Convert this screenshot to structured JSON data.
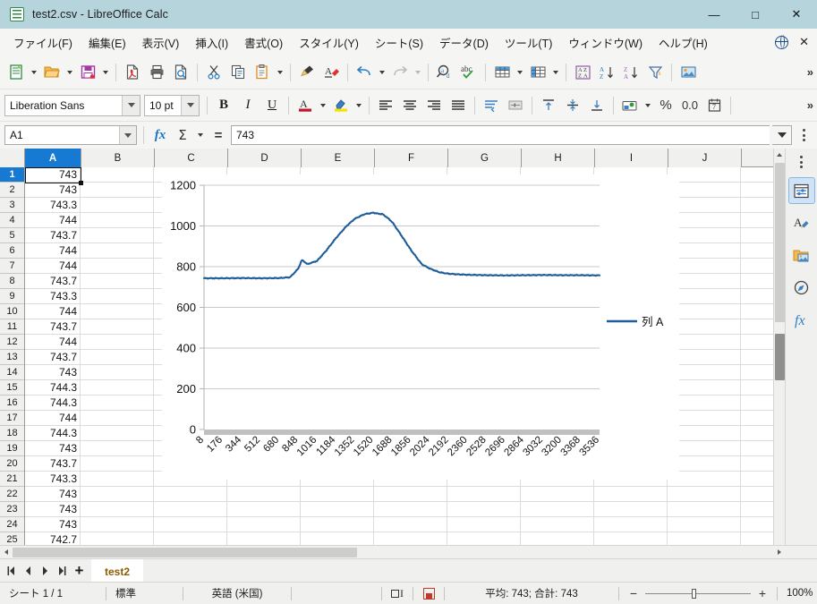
{
  "window": {
    "title": "test2.csv - LibreOffice Calc",
    "minimize": "—",
    "maximize": "□",
    "close": "✕"
  },
  "menubar": {
    "items": [
      {
        "label": "ファイル(F)"
      },
      {
        "label": "編集(E)"
      },
      {
        "label": "表示(V)"
      },
      {
        "label": "挿入(I)"
      },
      {
        "label": "書式(O)"
      },
      {
        "label": "スタイル(Y)"
      },
      {
        "label": "シート(S)"
      },
      {
        "label": "データ(D)"
      },
      {
        "label": "ツール(T)"
      },
      {
        "label": "ウィンドウ(W)"
      },
      {
        "label": "ヘルプ(H)"
      }
    ],
    "close_doc": "✕"
  },
  "toolbar": {
    "icons": [
      "new-document-icon",
      "open-file-icon",
      "save-icon",
      "export-pdf-icon",
      "print-icon",
      "print-preview-icon",
      "cut-icon",
      "copy-icon",
      "paste-icon",
      "clone-formatting-icon",
      "clear-formatting-icon",
      "undo-icon",
      "redo-icon",
      "find-replace-icon",
      "spelling-icon",
      "row-icon",
      "column-icon",
      "sort-icon",
      "sort-ascending-icon",
      "sort-descending-icon",
      "autofilter-icon",
      "insert-image-icon"
    ],
    "overflow": "»"
  },
  "formatbar": {
    "font_name": "Liberation Sans",
    "font_size": "10 pt",
    "bold": "B",
    "italic": "I",
    "underline": "U",
    "icons": [
      "font-color-icon",
      "highlight-color-icon",
      "align-left-icon",
      "align-center-icon",
      "align-right-icon",
      "align-justify-icon",
      "wrap-text-icon",
      "merge-cells-icon",
      "align-top-icon",
      "align-middle-icon",
      "align-bottom-icon",
      "format-currency-icon",
      "format-percent-icon",
      "format-number-icon",
      "format-date-icon"
    ],
    "percent_symbol": "%",
    "number_symbol": "0.0",
    "overflow": "»"
  },
  "formulabar": {
    "name_box": "A1",
    "function_wizard": "fx",
    "sum": "Σ",
    "formula": "=",
    "input_value": "743"
  },
  "grid": {
    "columns": [
      "A",
      "B",
      "C",
      "D",
      "E",
      "F",
      "G",
      "H",
      "I",
      "J"
    ],
    "selected_column": "A",
    "selected_cell": "A1",
    "rows": [
      {
        "num": "1",
        "a": "743"
      },
      {
        "num": "2",
        "a": "743"
      },
      {
        "num": "3",
        "a": "743.3"
      },
      {
        "num": "4",
        "a": "744"
      },
      {
        "num": "5",
        "a": "743.7"
      },
      {
        "num": "6",
        "a": "744"
      },
      {
        "num": "7",
        "a": "744"
      },
      {
        "num": "8",
        "a": "743.7"
      },
      {
        "num": "9",
        "a": "743.3"
      },
      {
        "num": "10",
        "a": "744"
      },
      {
        "num": "11",
        "a": "743.7"
      },
      {
        "num": "12",
        "a": "744"
      },
      {
        "num": "13",
        "a": "743.7"
      },
      {
        "num": "14",
        "a": "743"
      },
      {
        "num": "15",
        "a": "744.3"
      },
      {
        "num": "16",
        "a": "744.3"
      },
      {
        "num": "17",
        "a": "744"
      },
      {
        "num": "18",
        "a": "744.3"
      },
      {
        "num": "19",
        "a": "743"
      },
      {
        "num": "20",
        "a": "743.7"
      },
      {
        "num": "21",
        "a": "743.3"
      },
      {
        "num": "22",
        "a": "743"
      },
      {
        "num": "23",
        "a": "743"
      },
      {
        "num": "24",
        "a": "743"
      },
      {
        "num": "25",
        "a": "742.7"
      }
    ]
  },
  "chart_data": {
    "type": "line",
    "title": "",
    "xlabel": "",
    "ylabel": "",
    "ylim": [
      0,
      1200
    ],
    "yticks": [
      0,
      200,
      400,
      600,
      800,
      1000,
      1200
    ],
    "grid": true,
    "legend_position": "right",
    "series": [
      {
        "name": "列 A",
        "color": "#1f5d99",
        "x": [
          8,
          176,
          344,
          512,
          680,
          776,
          848,
          880,
          900,
          930,
          960,
          1016,
          1100,
          1184,
          1280,
          1352,
          1440,
          1520,
          1560,
          1600,
          1640,
          1688,
          1760,
          1856,
          1950,
          2024,
          2110,
          2192,
          2280,
          2360,
          2450,
          2528,
          2696,
          2864,
          3032,
          3200,
          3368,
          3536
        ],
        "values": [
          743,
          743,
          744,
          743,
          744,
          748,
          790,
          832,
          826,
          812,
          818,
          828,
          880,
          940,
          1000,
          1035,
          1058,
          1065,
          1060,
          1058,
          1042,
          1018,
          960,
          880,
          812,
          790,
          772,
          765,
          762,
          760,
          759,
          758,
          757,
          758,
          759,
          758,
          758,
          757
        ]
      }
    ],
    "xticks": [
      8,
      176,
      344,
      512,
      680,
      848,
      1016,
      1184,
      1352,
      1520,
      1688,
      1856,
      2024,
      2192,
      2360,
      2528,
      2696,
      2864,
      3032,
      3200,
      3368,
      3536
    ]
  },
  "sheettabs": {
    "first": "⏮",
    "prev": "◀",
    "next": "▶",
    "last": "⏭",
    "add": "+",
    "tabs": [
      {
        "label": "test2",
        "active": true
      }
    ]
  },
  "statusbar": {
    "sheet_info": "シート 1 / 1",
    "page_style": "標準",
    "language": "英語 (米国)",
    "insert_mode": "",
    "save_status": "save-modified-icon",
    "selection_summary": "平均: 743; 合計: 743",
    "zoom_minus": "−",
    "zoom_plus": "+",
    "zoom_level": "100%"
  },
  "sidebar": {
    "items": [
      {
        "name": "properties",
        "icon": "properties-icon",
        "active": true
      },
      {
        "name": "styles",
        "icon": "styles-icon",
        "active": false
      },
      {
        "name": "gallery",
        "icon": "gallery-icon",
        "active": false
      },
      {
        "name": "navigator",
        "icon": "navigator-icon",
        "active": false
      },
      {
        "name": "functions",
        "icon": "functions-icon",
        "active": false
      }
    ]
  },
  "colors": {
    "titlebar": "#b6d4dc",
    "accent": "#1679d2",
    "chart_line": "#1f5d99"
  }
}
